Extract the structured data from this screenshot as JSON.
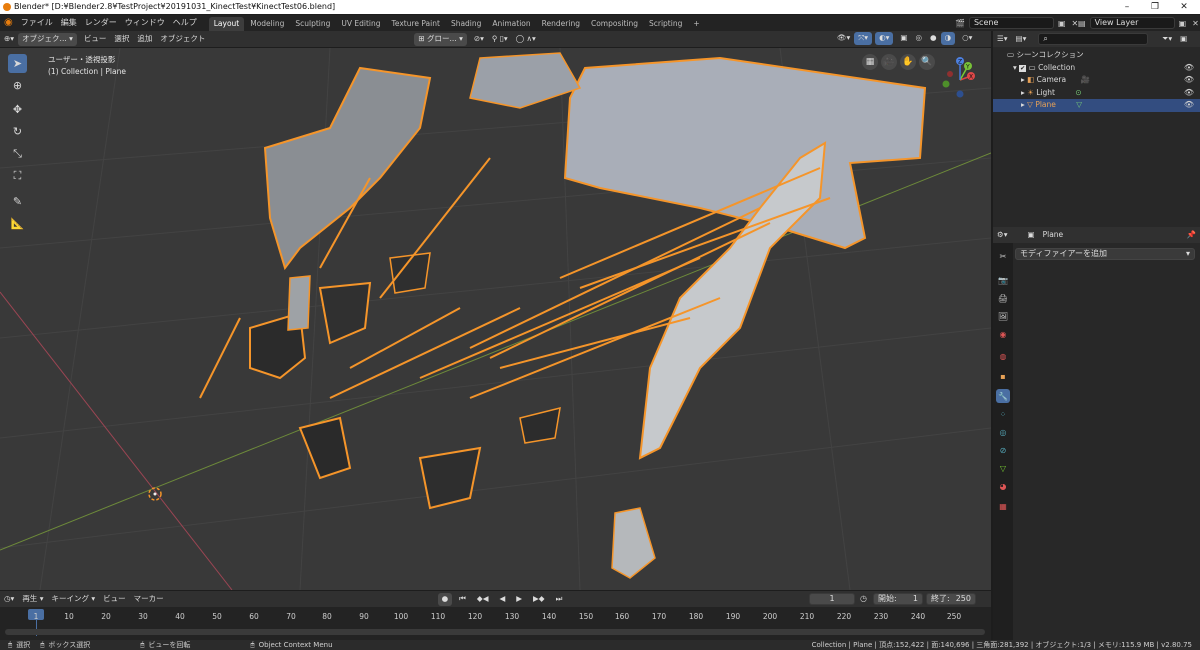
{
  "window": {
    "title": "Blender* [D:¥Blender2.8¥TestProject¥20191031_KinectTest¥KinectTest06.blend]",
    "minimize": "–",
    "maximize": "❐",
    "close": "✕"
  },
  "menus": [
    "ファイル",
    "編集",
    "レンダー",
    "ウィンドウ",
    "ヘルプ"
  ],
  "workspaces": [
    "Layout",
    "Modeling",
    "Sculpting",
    "UV Editing",
    "Texture Paint",
    "Shading",
    "Animation",
    "Rendering",
    "Compositing",
    "Scripting"
  ],
  "add_tab": "+",
  "scene": "Scene",
  "view_layer": "View Layer",
  "viewport_header": {
    "mode": "オブジェク...",
    "view": "ビュー",
    "select": "選択",
    "add": "追加",
    "object": "オブジェクト",
    "orientation": "グロー..."
  },
  "viewport_overlay": {
    "projection": "ユーザー・透視投影",
    "collection_info": "(1) Collection | Plane"
  },
  "gizmo": {
    "x": "X",
    "y": "Y",
    "z": "Z"
  },
  "outliner": {
    "root": "シーンコレクション",
    "items": [
      {
        "name": "Collection",
        "color": "#d9d9d9"
      },
      {
        "name": "Camera",
        "color": "#d9d9d9"
      },
      {
        "name": "Light",
        "color": "#d9d9d9"
      },
      {
        "name": "Plane",
        "color": "#e8a257"
      }
    ]
  },
  "properties": {
    "object_name": "Plane",
    "add_modifier": "モディファイアーを追加"
  },
  "timeline": {
    "play": "再生",
    "keying": "キーイング",
    "view": "ビュー",
    "marker": "マーカー",
    "current_frame": "1",
    "start_label": "開始:",
    "start": "1",
    "end_label": "終了:",
    "end": "250",
    "ticks": [
      "1",
      "10",
      "20",
      "30",
      "40",
      "50",
      "60",
      "70",
      "80",
      "90",
      "100",
      "110",
      "120",
      "130",
      "140",
      "150",
      "160",
      "170",
      "180",
      "190",
      "200",
      "210",
      "220",
      "230",
      "240",
      "250"
    ]
  },
  "status": {
    "select": "選択",
    "box_select": "ボックス選択",
    "rotate_view": "ビューを回転",
    "context_menu": "Object Context Menu",
    "stats": "Collection | Plane | 頂点:152,422 | 面:140,696 | 三角面:281,392 | オブジェクト:1/3 | メモリ:115.9 MB | v2.80.75"
  },
  "colors": {
    "accent": "#4a6fa3",
    "selection": "#f5952a",
    "active_tab": "#3d3d3d"
  }
}
